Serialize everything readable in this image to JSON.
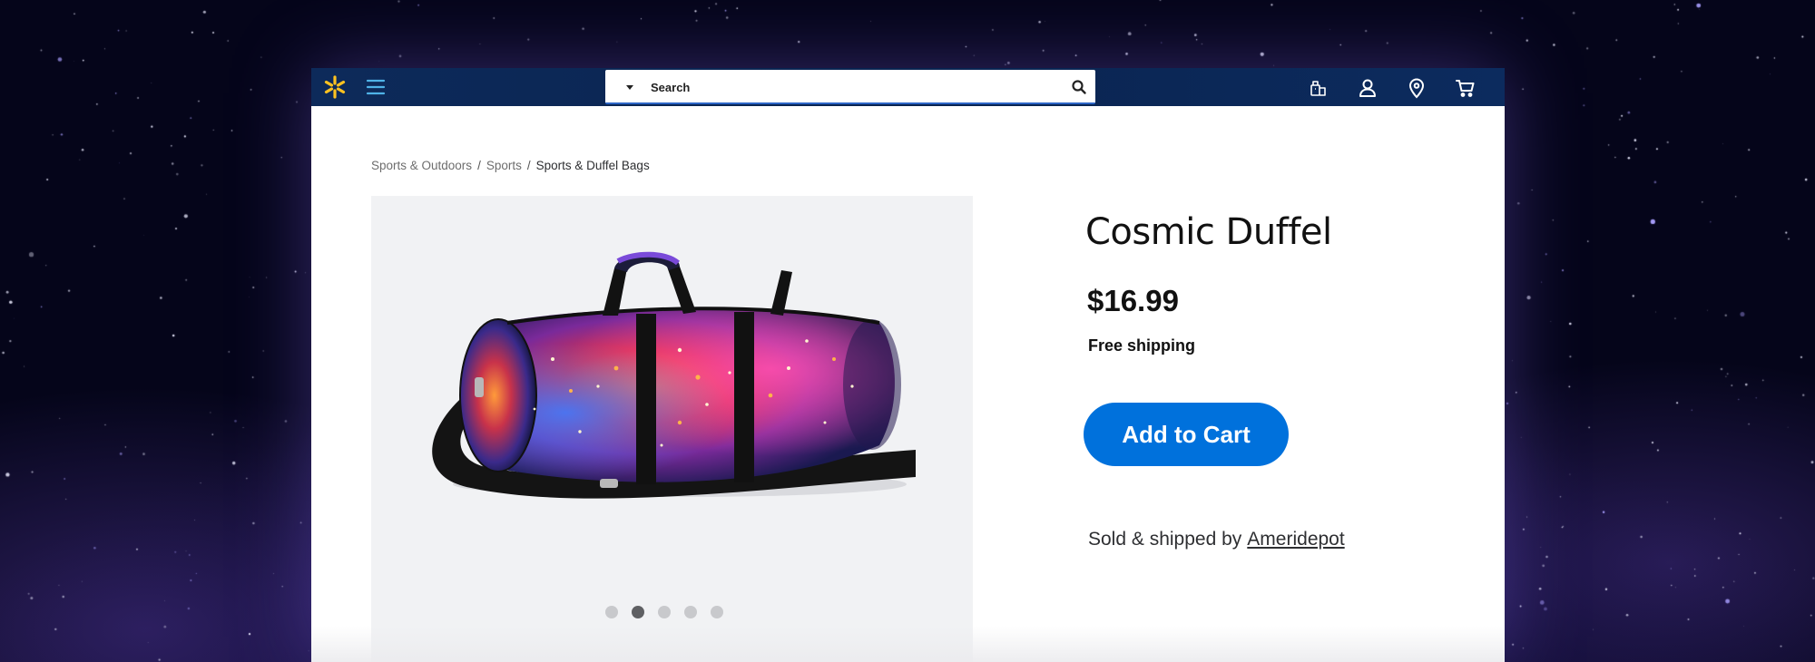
{
  "colors": {
    "header_bg": "#0a2450",
    "spark_yellow": "#ffc220",
    "accent_blue": "#0071dc",
    "gallery_bg": "#f1f2f4"
  },
  "header": {
    "logo_icon": "spark-icon",
    "menu_icon": "hamburger-menu-icon",
    "search": {
      "placeholder": "Search",
      "department_icon": "caret-down-icon",
      "button_icon": "search-icon"
    },
    "right_icons": [
      "reorder-icon",
      "account-icon",
      "location-pin-icon",
      "cart-icon"
    ]
  },
  "breadcrumb": {
    "items": [
      {
        "label": "Sports & Outdoors"
      },
      {
        "label": "Sports"
      },
      {
        "label": "Sports & Duffel Bags"
      }
    ],
    "separator": "/"
  },
  "gallery": {
    "image": "galaxy-print-duffel-bag",
    "dots_count": 5,
    "active_dot_index": 1
  },
  "product": {
    "title": "Cosmic Duffel",
    "price": "$16.99",
    "shipping": "Free shipping",
    "add_to_cart_label": "Add to Cart",
    "seller_prefix": "Sold & shipped by",
    "seller_name": "Ameridepot"
  }
}
